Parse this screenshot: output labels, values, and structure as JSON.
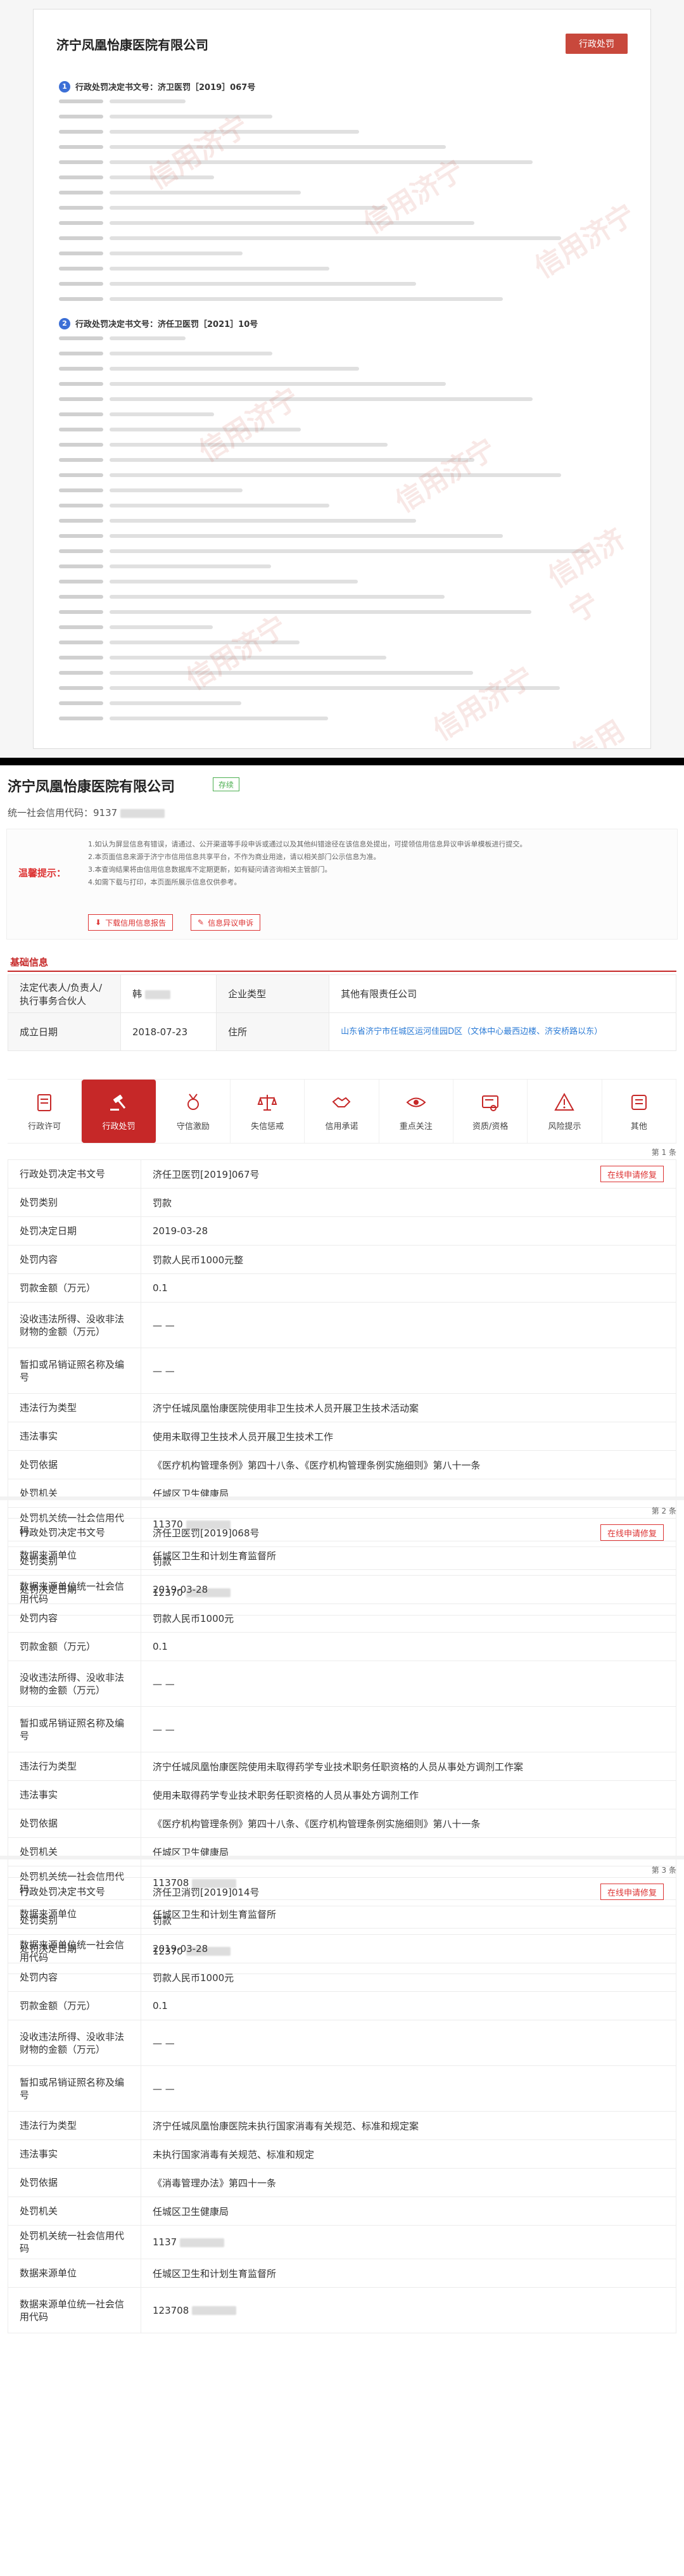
{
  "top_doc": {
    "title": "济宁凤凰怡康医院有限公司",
    "stamp": "行政处罚",
    "sections": [
      {
        "number": "1",
        "heading": "行政处罚决定书文号：济卫医罚［2019］067号"
      },
      {
        "number": "2",
        "heading": "行政处罚决定书文号：济任卫医罚［2021］10号"
      }
    ],
    "watermark": "信用济宁"
  },
  "company": {
    "name": "济宁凤凰怡康医院有限公司",
    "status": "存续",
    "credit_code_label": "统一社会信用代码：",
    "credit_code": "9137"
  },
  "notice": {
    "label": "温馨提示：",
    "lines": [
      "1.如认为屏显信息有错误，请通过、公开渠道等手段申诉或通过以及其他纠错途径在该信息处提出，可提领信用信息异议申诉单模板进行提交。",
      "2.本页面信息来源于济宁市信用信息共享平台，不作为商业用途，请以相关部门公示信息为准。",
      "3.本查询结果将由信用信息数据库不定期更新，如有疑问请咨询相关主管部门。",
      "4.如需下载与打印，本页面所展示信息仅供参考。"
    ],
    "btn_download": "下载信用信息报告",
    "btn_report": "信息异议申诉"
  },
  "basic_info": {
    "section_label": "基础信息",
    "rows": [
      [
        "法定代表人/负责人/执行事务合伙人",
        "韩",
        "企业类型",
        "其他有限责任公司"
      ],
      [
        "成立日期",
        "2018-07-23",
        "住所",
        "山东省济宁市任城区运河佳园D区（文体中心最西边楼、济安桥路以东）"
      ]
    ]
  },
  "tabs": [
    {
      "label": "行政许可",
      "icon": "license-icon"
    },
    {
      "label": "行政处罚",
      "icon": "gavel-icon"
    },
    {
      "label": "守信激励",
      "icon": "medal-icon"
    },
    {
      "label": "失信惩戒",
      "icon": "scale-icon"
    },
    {
      "label": "信用承诺",
      "icon": "handshake-icon"
    },
    {
      "label": "重点关注",
      "icon": "eye-icon"
    },
    {
      "label": "资质/资格",
      "icon": "certificate-icon"
    },
    {
      "label": "风险提示",
      "icon": "warning-icon"
    },
    {
      "label": "其他",
      "icon": "more-icon"
    }
  ],
  "record_labels": {
    "decision_no": "行政处罚决定书文号",
    "category": "处罚类别",
    "decision_date": "处罚决定日期",
    "content": "处罚内容",
    "amount": "罚款金额（万元）",
    "confiscated": "没收违法所得、没收非法财物的金额（万元）",
    "suspended": "暂扣或吊销证照名称及编号",
    "violation_type": "违法行为类型",
    "facts": "违法事实",
    "basis": "处罚依据",
    "authority": "处罚机关",
    "authority_code": "处罚机关统一社会信用代码",
    "source": "数据来源单位",
    "source_code": "数据来源单位统一社会信用代码"
  },
  "records": [
    {
      "page": "第 1 条",
      "action": "在线申请修复",
      "decision_no": "济任卫医罚[2019]067号",
      "category": "罚款",
      "decision_date": "2019-03-28",
      "content": "罚款人民币1000元整",
      "amount": "0.1",
      "confiscated": "— —",
      "suspended": "— —",
      "violation_type": "济宁任城凤凰怡康医院使用非卫生技术人员开展卫生技术活动案",
      "facts": "使用未取得卫生技术人员开展卫生技术工作",
      "basis": "《医疗机构管理条例》第四十八条、《医疗机构管理条例实施细则》第八十一条",
      "authority": "任城区卫生健康局",
      "authority_code": "11370",
      "source": "任城区卫生和计划生育监督所",
      "source_code": "12370"
    },
    {
      "page": "第 2 条",
      "action": "在线申请修复",
      "decision_no": "济任卫医罚[2019]068号",
      "category": "罚款",
      "decision_date": "2019-03-28",
      "content": "罚款人民币1000元",
      "amount": "0.1",
      "confiscated": "— —",
      "suspended": "— —",
      "violation_type": "济宁任城凤凰怡康医院使用未取得药学专业技术职务任职资格的人员从事处方调剂工作案",
      "facts": "使用未取得药学专业技术职务任职资格的人员从事处方调剂工作",
      "basis": "《医疗机构管理条例》第四十八条、《医疗机构管理条例实施细则》第八十一条",
      "authority": "任城区卫生健康局",
      "authority_code": "113708",
      "source": "任城区卫生和计划生育监督所",
      "source_code": "12370"
    },
    {
      "page": "第 3 条",
      "action": "在线申请修复",
      "decision_no": "济任卫消罚[2019]014号",
      "category": "罚款",
      "decision_date": "2019-03-28",
      "content": "罚款人民币1000元",
      "amount": "0.1",
      "confiscated": "— —",
      "suspended": "— —",
      "violation_type": "济宁任城凤凰怡康医院未执行国家消毒有关规范、标准和规定案",
      "facts": "未执行国家消毒有关规范、标准和规定",
      "basis": "《消毒管理办法》第四十一条",
      "authority": "任城区卫生健康局",
      "authority_code": "1137",
      "source": "任城区卫生和计划生育监督所",
      "source_code": "123708"
    }
  ]
}
